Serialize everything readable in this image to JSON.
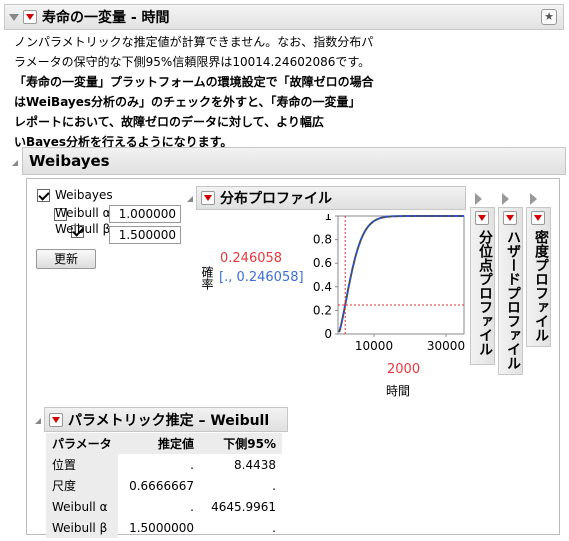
{
  "report": {
    "title": "寿命の一変量 - 時間",
    "message_lines": [
      "ノンパラメトリックな推定値が計算できません。なお、指数分布パ",
      "ラメータの保守的な下側95%信頼限界は10014.24602086です。"
    ],
    "bold_lines": [
      "「寿命の一変量」プラットフォームの環境設定で「故障ゼロの場合",
      "はWeiBayes分析のみ」のチェックを外すと、「寿命の一変量」",
      "レポートにおいて、故障ゼロのデータに対して、より幅広",
      "いBayes分析を行えるようになります。"
    ]
  },
  "weibayes": {
    "title": "Weibayes",
    "checkbox_weibayes": {
      "label": "Weibayes",
      "checked": true
    },
    "weibull_alpha": {
      "label": "Weibull α",
      "checked": false,
      "value": "1.000000"
    },
    "weibull_beta": {
      "label": "Weibull β",
      "checked": true,
      "value": "1.500000"
    },
    "update_button": "更新"
  },
  "profile": {
    "title": "分布プロファイル",
    "y_label": "確率",
    "current_value": "0.246058",
    "interval": "[., 0.246058]",
    "x_label": "時間",
    "x_current": "2000",
    "y_ticks": [
      "1",
      "0.8",
      "0.6",
      "0.4",
      "0.2",
      "0"
    ],
    "x_ticks": [
      "10000",
      "30000"
    ]
  },
  "side_tabs": {
    "quantile": "分位点プロファイル",
    "hazard": "ハザードプロファイル",
    "density": "密度プロファイル"
  },
  "estimates": {
    "title": "パラメトリック推定 – Weibull",
    "headers": [
      "パラメータ",
      "推定値",
      "下側95%"
    ],
    "rows": [
      [
        "位置",
        ".",
        "8.4438"
      ],
      [
        "尺度",
        "0.6666667",
        "."
      ],
      [
        "Weibull α",
        ".",
        "4645.9961"
      ],
      [
        "Weibull β",
        "1.5000000",
        "."
      ]
    ]
  },
  "colors": {
    "red_value": "#e8383d",
    "blue_value": "#3a6fd8",
    "curve_blue": "#2b55c8",
    "curve_dash": "#5a4a2a",
    "ref_line": "#e03030"
  },
  "chart_data": {
    "type": "line",
    "x_range": [
      0,
      35000
    ],
    "y_range": [
      0,
      1
    ],
    "current_x": 2000,
    "current_y": 0.246058,
    "weibull_alpha": 4645.9961,
    "weibull_beta": 1.5
  }
}
